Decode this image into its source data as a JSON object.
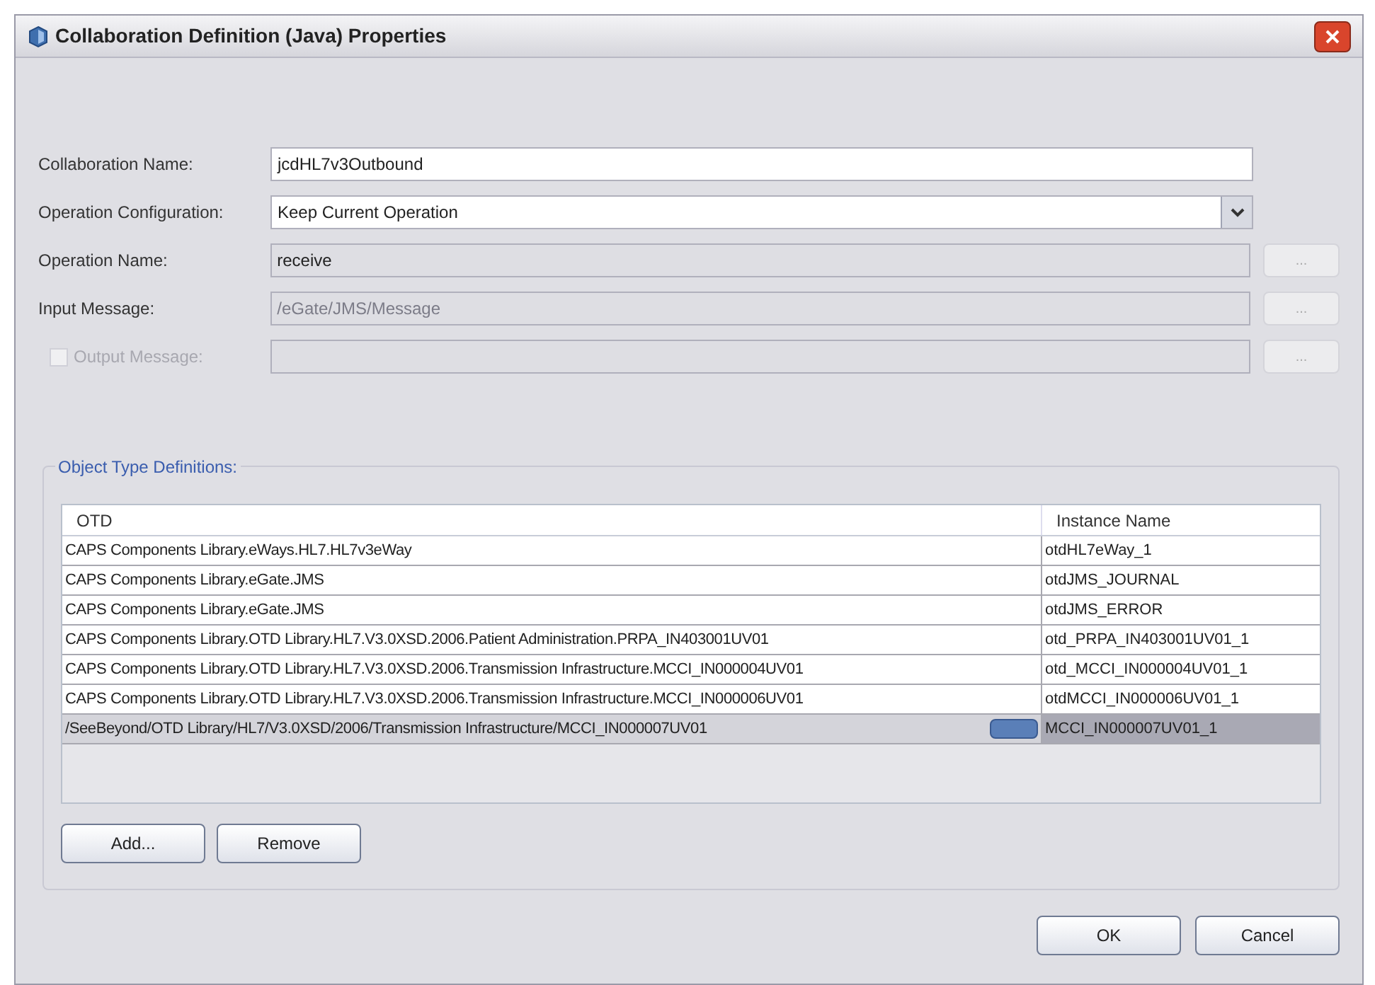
{
  "window": {
    "title": "Collaboration Definition (Java) Properties"
  },
  "fields": [
    {
      "kind": "text",
      "label": "Collaboration Name:",
      "value": "jcdHL7v3Outbound",
      "disabled": false
    },
    {
      "kind": "dropdown",
      "label": "Operation Configuration:",
      "value": "Keep Current Operation",
      "disabled": false
    },
    {
      "kind": "readonly",
      "label": "Operation Name:",
      "value": "receive",
      "disabled": false,
      "browse": "..."
    },
    {
      "kind": "readonly",
      "label": "Input Message:",
      "value": "/eGate/JMS/Message",
      "disabled": true,
      "browse": "..."
    },
    {
      "kind": "checkbox",
      "label": "Output Message:",
      "checked": false,
      "disabled": true,
      "browse": "..."
    }
  ],
  "otd_group": {
    "title": "Object Type Definitions:",
    "columns": [
      "OTD",
      "Instance Name"
    ],
    "rows": [
      {
        "otd": "CAPS Components Library.eWays.HL7.HL7v3eWay",
        "instance": "otdHL7eWay_1",
        "selected": false
      },
      {
        "otd": "CAPS Components Library.eGate.JMS",
        "instance": "otdJMS_JOURNAL",
        "selected": false
      },
      {
        "otd": "CAPS Components Library.eGate.JMS",
        "instance": "otdJMS_ERROR",
        "selected": false
      },
      {
        "otd": "CAPS Components Library.OTD Library.HL7.V3.0XSD.2006.Patient Administration.PRPA_IN403001UV01",
        "instance": "otd_PRPA_IN403001UV01_1",
        "selected": false
      },
      {
        "otd": "CAPS Components Library.OTD Library.HL7.V3.0XSD.2006.Transmission Infrastructure.MCCI_IN000004UV01",
        "instance": "otd_MCCI_IN000004UV01_1",
        "selected": false
      },
      {
        "otd": "CAPS Components Library.OTD Library.HL7.V3.0XSD.2006.Transmission Infrastructure.MCCI_IN000006UV01",
        "instance": "otdMCCI_IN000006UV01_1",
        "selected": false
      },
      {
        "otd": "/SeeBeyond/OTD Library/HL7/V3.0XSD/2006/Transmission Infrastructure/MCCI_IN000007UV01",
        "instance": "MCCI_IN000007UV01_1",
        "selected": true
      }
    ],
    "buttons": [
      "Add...",
      "Remove"
    ]
  },
  "buttons": [
    "OK",
    "Cancel"
  ]
}
